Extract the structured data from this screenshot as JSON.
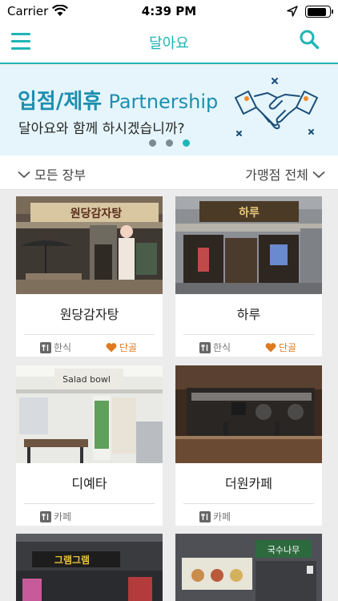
{
  "status": {
    "carrier": "Carrier",
    "time": "4:39 PM",
    "battery_level": 0.9
  },
  "header": {
    "title": "달아요"
  },
  "banner": {
    "title_ko": "입점/제휴",
    "title_en": "Partnership",
    "subtitle": "달아요와 함께 하시겠습니까?",
    "pager": {
      "count": 3,
      "active": 2
    },
    "accent": "#1fb5b5"
  },
  "filters": {
    "left": "모든 장부",
    "right": "가맹점 전체"
  },
  "stores": [
    {
      "name": "원당감자탕",
      "category": "한식",
      "badge": "단골",
      "sign": "원당감자탕"
    },
    {
      "name": "하루",
      "category": "한식",
      "badge": "단골",
      "sign": "하루"
    },
    {
      "name": "디예타",
      "category": "카페",
      "badge": "",
      "sign": "Salad bowl"
    },
    {
      "name": "더원카페",
      "category": "카페",
      "badge": "",
      "sign": ""
    },
    {
      "name": "",
      "category": "",
      "badge": "",
      "sign": "그램그램"
    },
    {
      "name": "",
      "category": "",
      "badge": "",
      "sign": "국수나무"
    }
  ]
}
